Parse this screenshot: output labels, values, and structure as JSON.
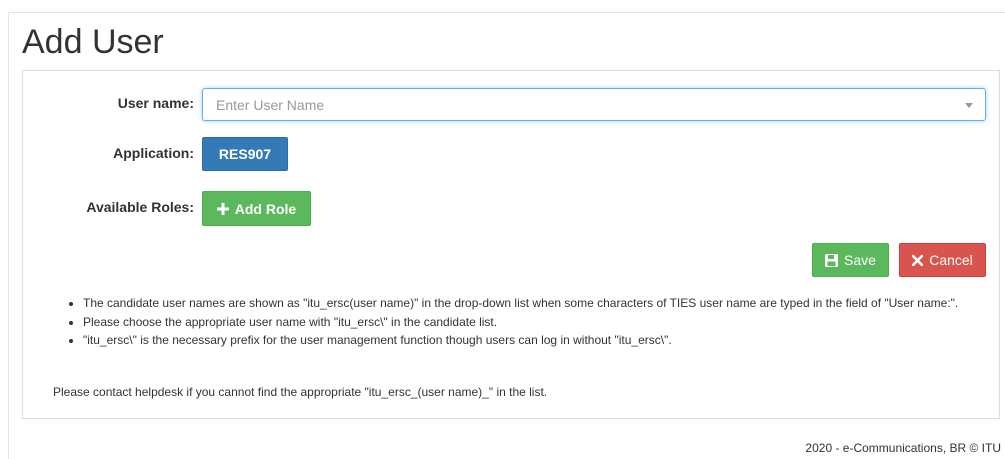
{
  "page": {
    "title": "Add User"
  },
  "form": {
    "user_name_label": "User name:",
    "user_name_placeholder": "Enter User Name",
    "application_label": "Application:",
    "application_value": "RES907",
    "roles_label": "Available Roles:",
    "add_role_label": "Add Role"
  },
  "actions": {
    "save_label": "Save",
    "cancel_label": "Cancel"
  },
  "notes": [
    "The candidate user names are shown as \"itu_ersc(user name)\" in the drop-down list when some characters of TIES user name are typed in the field of \"User name:\".",
    "Please choose the appropriate user name with \"itu_ersc\\\" in the candidate list.",
    "\"itu_ersc\\\" is the necessary prefix for the user management function though users can log in without \"itu_ersc\\\"."
  ],
  "helpdesk_text": "Please contact helpdesk if you cannot find the appropriate \"itu_ersc_(user name)_\" in the list.",
  "footer_text": "2020 - e-Communications, BR © ITU",
  "colors": {
    "primary": "#337ab7",
    "success": "#5cb85c",
    "danger": "#d9534f"
  },
  "icons": {
    "add_role": "plus-icon",
    "save": "floppy-disk-icon",
    "cancel": "x-icon",
    "dropdown": "caret-down-icon"
  }
}
